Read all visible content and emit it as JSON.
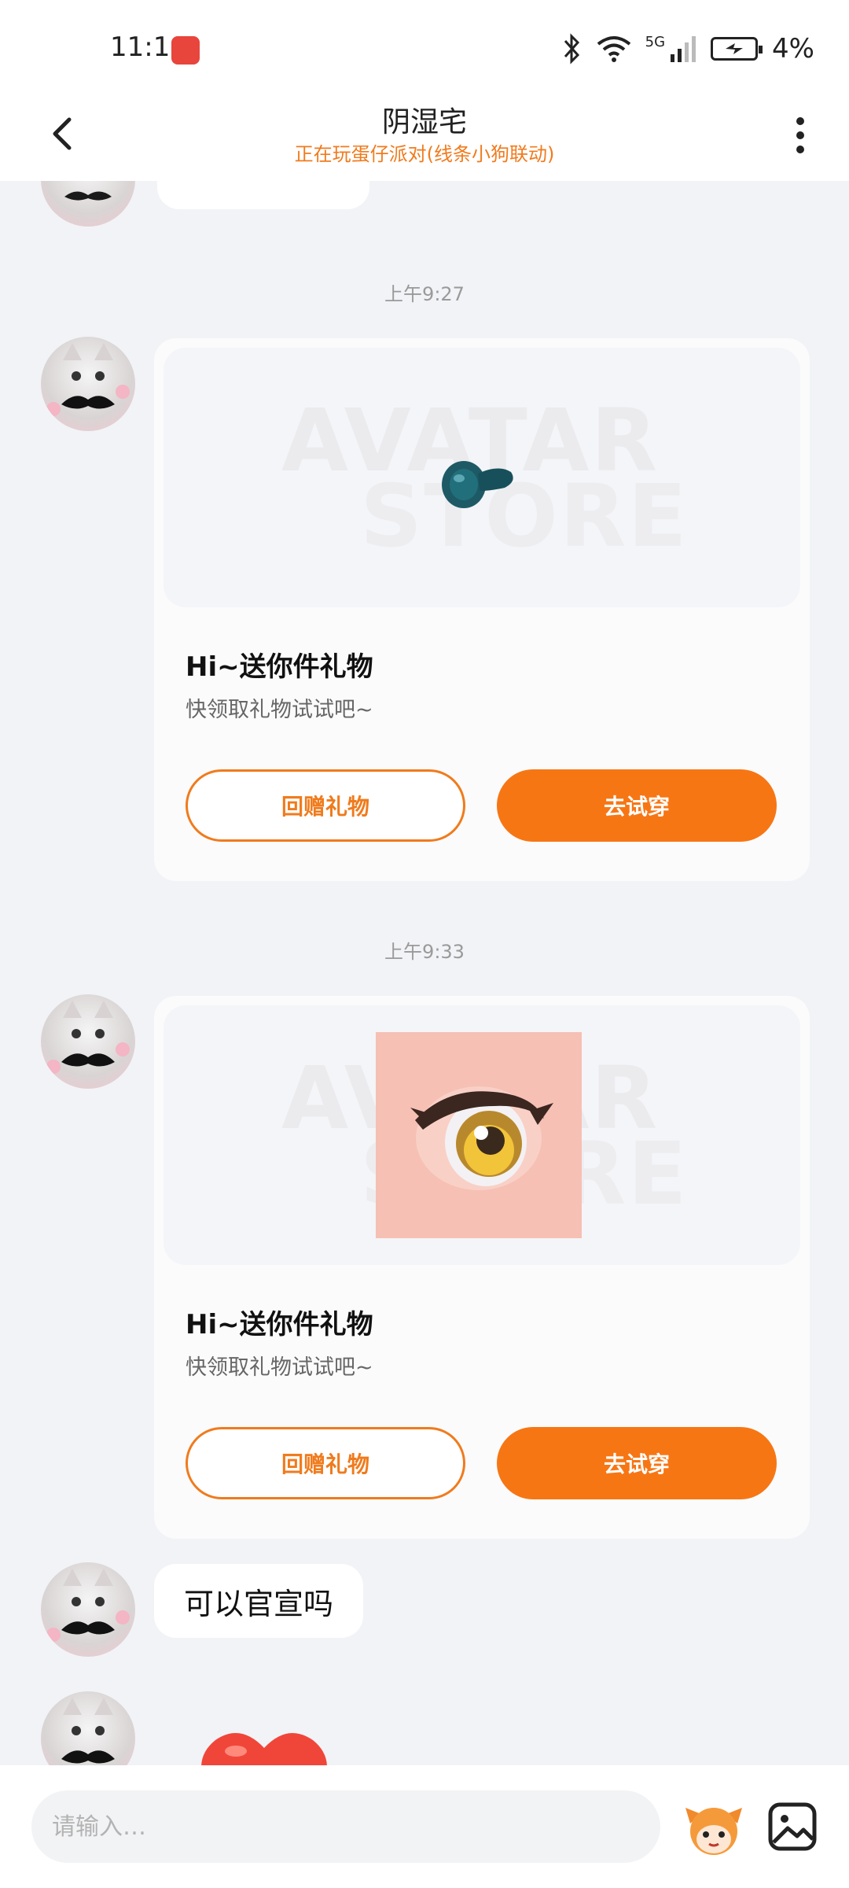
{
  "status_bar": {
    "time": "11:16",
    "network": "5G",
    "battery": "4%"
  },
  "header": {
    "title": "阴湿宅",
    "subtitle": "正在玩蛋仔派对(线条小狗联动)"
  },
  "chat": {
    "timestamps": [
      "上午9:27",
      "上午9:33"
    ],
    "cards": [
      {
        "watermark_line1": "AVATAR",
        "watermark_line2": "STORE",
        "item_icon": "pacifier-item-icon",
        "title": "Hi~送你件礼物",
        "description": "快领取礼物试试吧~",
        "return_gift_label": "回赠礼物",
        "try_on_label": "去试穿"
      },
      {
        "watermark_line1": "AVATAR",
        "watermark_line2": "STORE",
        "item_icon": "anime-eye-item-icon",
        "title": "Hi~送你件礼物",
        "description": "快领取礼物试试吧~",
        "return_gift_label": "回赠礼物",
        "try_on_label": "去试穿"
      }
    ],
    "text_message": "可以官宣吗",
    "sticker": "heart-sticker"
  },
  "input_bar": {
    "placeholder": "请输入…"
  },
  "colors": {
    "accent": "#f77614",
    "subtitle": "#f07b1d",
    "background": "#f2f3f7"
  }
}
